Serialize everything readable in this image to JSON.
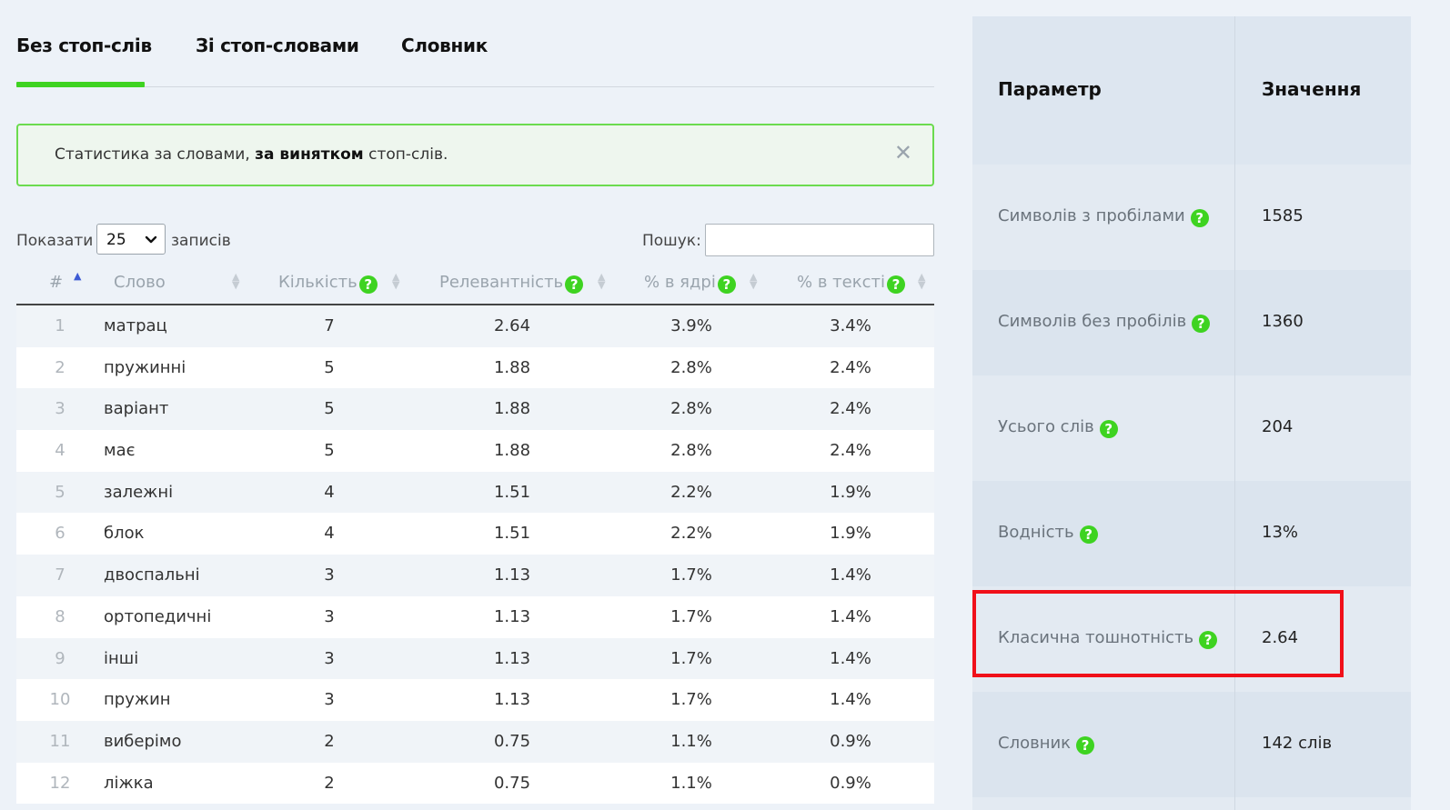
{
  "tabs": [
    {
      "label": "Без стоп-слів"
    },
    {
      "label": "Зі стоп-словами"
    },
    {
      "label": "Словник"
    }
  ],
  "alert": {
    "text_before": "Статистика за словами, ",
    "text_bold": "за винятком",
    "text_after": " стоп-слів.",
    "close_glyph": "✕"
  },
  "controls": {
    "show_label": "Показати",
    "page_size": "25",
    "records_label": "записів",
    "search_label": "Пошук:",
    "search_value": ""
  },
  "table": {
    "headers": {
      "num": "#",
      "word": "Слово",
      "count": "Кількість",
      "relevance": "Релевантність",
      "core": "% в ядрі",
      "text": "% в тексті"
    },
    "rows": [
      {
        "n": "1",
        "word": "матрац",
        "count": "7",
        "rel": "2.64",
        "core": "3.9%",
        "text": "3.4%"
      },
      {
        "n": "2",
        "word": "пружинні",
        "count": "5",
        "rel": "1.88",
        "core": "2.8%",
        "text": "2.4%"
      },
      {
        "n": "3",
        "word": "варіант",
        "count": "5",
        "rel": "1.88",
        "core": "2.8%",
        "text": "2.4%"
      },
      {
        "n": "4",
        "word": "має",
        "count": "5",
        "rel": "1.88",
        "core": "2.8%",
        "text": "2.4%"
      },
      {
        "n": "5",
        "word": "залежні",
        "count": "4",
        "rel": "1.51",
        "core": "2.2%",
        "text": "1.9%"
      },
      {
        "n": "6",
        "word": "блок",
        "count": "4",
        "rel": "1.51",
        "core": "2.2%",
        "text": "1.9%"
      },
      {
        "n": "7",
        "word": "двоспальні",
        "count": "3",
        "rel": "1.13",
        "core": "1.7%",
        "text": "1.4%"
      },
      {
        "n": "8",
        "word": "ортопедичні",
        "count": "3",
        "rel": "1.13",
        "core": "1.7%",
        "text": "1.4%"
      },
      {
        "n": "9",
        "word": "інші",
        "count": "3",
        "rel": "1.13",
        "core": "1.7%",
        "text": "1.4%"
      },
      {
        "n": "10",
        "word": "пружин",
        "count": "3",
        "rel": "1.13",
        "core": "1.7%",
        "text": "1.4%"
      },
      {
        "n": "11",
        "word": "виберімо",
        "count": "2",
        "rel": "0.75",
        "core": "1.1%",
        "text": "0.9%"
      },
      {
        "n": "12",
        "word": "ліжка",
        "count": "2",
        "rel": "0.75",
        "core": "1.1%",
        "text": "0.9%"
      }
    ]
  },
  "params": {
    "header_param": "Параметр",
    "header_value": "Значення",
    "rows": [
      {
        "name": "Символів з пробілами",
        "value": "1585"
      },
      {
        "name": "Символів без пробілів",
        "value": "1360"
      },
      {
        "name": "Усього слів",
        "value": "204"
      },
      {
        "name": "Водність",
        "value": "13%"
      },
      {
        "name": "Класична тошнотність",
        "value": "2.64"
      },
      {
        "name": "Словник",
        "value": "142 слів"
      }
    ]
  },
  "icons": {
    "help": "?",
    "sort_up": "▲",
    "sort_down": "▼",
    "select_chevron": "⌄"
  },
  "colors": {
    "accent_green": "#3ed321",
    "highlight_red": "#f0101a",
    "sort_active": "#3d5bd4"
  }
}
